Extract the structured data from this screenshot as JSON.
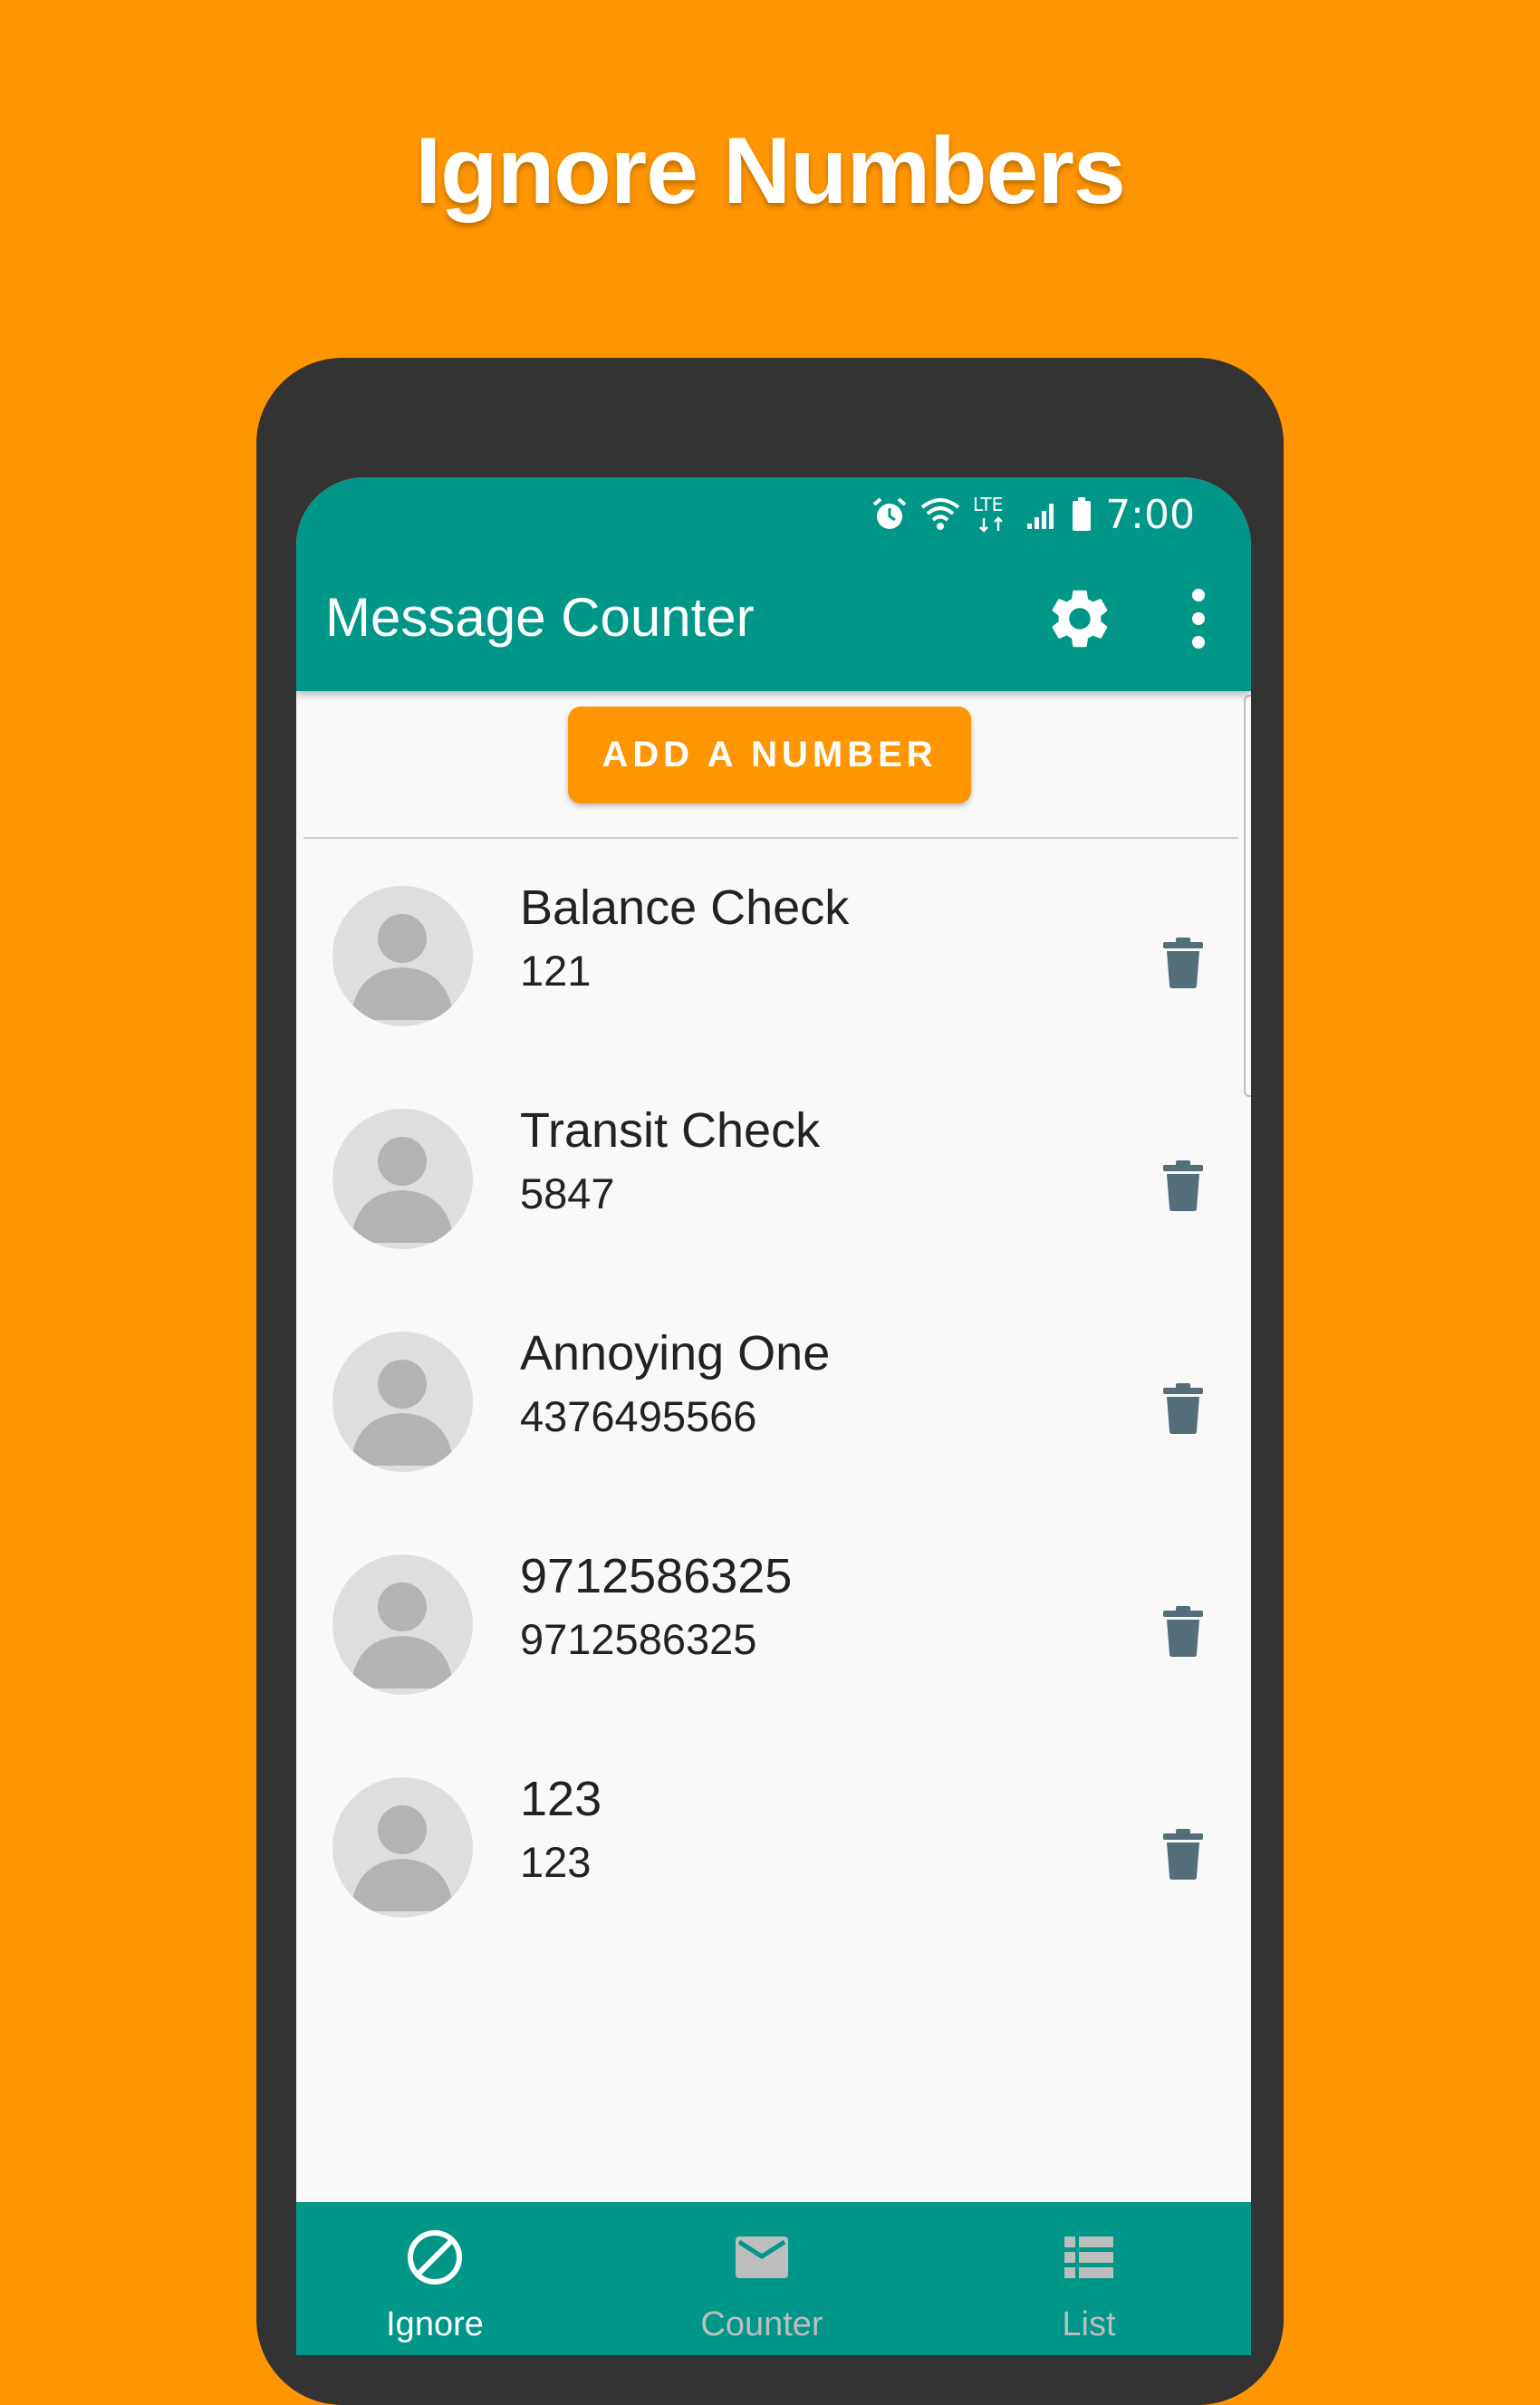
{
  "headline": "Ignore Numbers",
  "colors": {
    "background": "#FF9500",
    "app_bar": "#009688",
    "accent_button": "#FF9500",
    "trash_icon": "#546E7A",
    "nav_inactive": "#BDBDBD"
  },
  "status_bar": {
    "time": "7:00",
    "network": "LTE",
    "icons": [
      "alarm-icon",
      "wifi-icon",
      "lte-icon",
      "signal-icon",
      "battery-icon"
    ]
  },
  "app_bar": {
    "title": "Message Counter",
    "actions": [
      "settings-gear-icon",
      "more-vert-icon"
    ]
  },
  "add_button": {
    "label": "ADD A NUMBER"
  },
  "ignored_numbers": [
    {
      "name": "Balance Check",
      "number": "121"
    },
    {
      "name": "Transit Check",
      "number": "5847"
    },
    {
      "name": "Annoying One",
      "number": "4376495566"
    },
    {
      "name": "9712586325",
      "number": "9712586325"
    },
    {
      "name": "123",
      "number": "123"
    }
  ],
  "bottom_nav": {
    "selected": "Ignore",
    "items": [
      {
        "label": "Ignore",
        "icon": "block-icon"
      },
      {
        "label": "Counter",
        "icon": "mail-icon"
      },
      {
        "label": "List",
        "icon": "list-icon"
      }
    ]
  }
}
